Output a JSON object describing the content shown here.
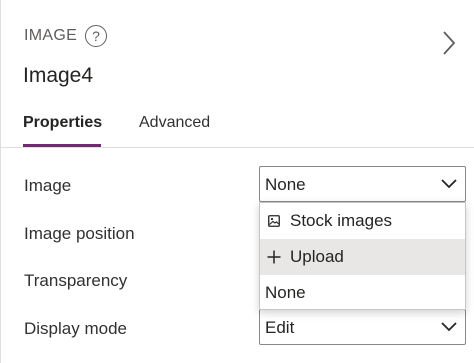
{
  "header": {
    "kind": "IMAGE",
    "help_glyph": "?",
    "control_name": "Image4"
  },
  "tabs": [
    {
      "label": "Properties",
      "active": true
    },
    {
      "label": "Advanced",
      "active": false
    }
  ],
  "properties": {
    "image": {
      "label": "Image",
      "value": "None"
    },
    "image_position": {
      "label": "Image position"
    },
    "transparency": {
      "label": "Transparency"
    },
    "display_mode": {
      "label": "Display mode",
      "value": "Edit"
    }
  },
  "dropdown": {
    "items": [
      {
        "label": "Stock images",
        "icon": "image-icon",
        "highlighted": false
      },
      {
        "label": "Upload",
        "icon": "plus-icon",
        "highlighted": true
      },
      {
        "label": "None",
        "icon": null,
        "highlighted": false
      }
    ]
  },
  "colors": {
    "accent": "#742774",
    "hover": "#e8e7e6",
    "border": "#8a8886"
  }
}
